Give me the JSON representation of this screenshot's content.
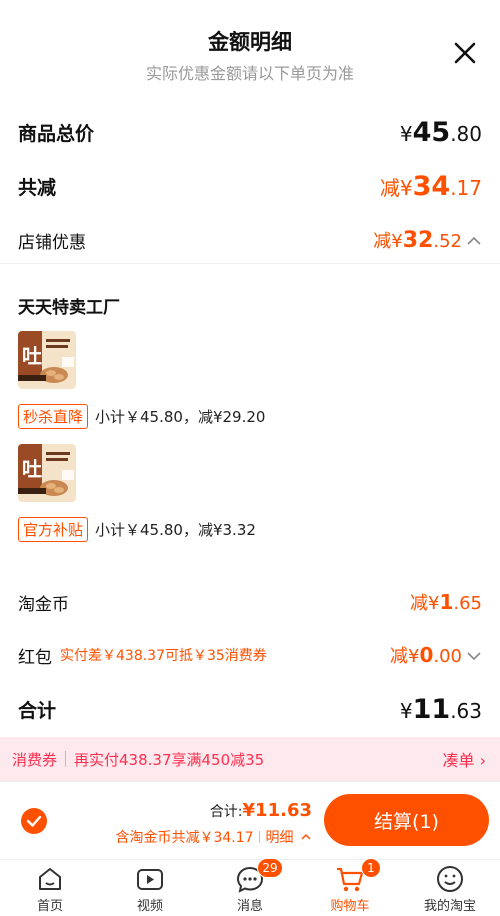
{
  "header": {
    "title": "金额明细",
    "subtitle": "实际优惠金额请以下单页为准"
  },
  "summary": {
    "total_label": "商品总价",
    "total_symbol": "¥",
    "total_int": "45",
    "total_dec": ".80",
    "reduce_label": "共减",
    "reduce_symbol": "减¥",
    "reduce_int": "34",
    "reduce_dec": ".17",
    "shop_label": "店铺优惠",
    "shop_symbol": "减¥",
    "shop_int": "32",
    "shop_dec": ".52"
  },
  "shop": {
    "name": "天天特卖工厂",
    "items": [
      {
        "tag": "秒杀直降",
        "text": "小计￥45.80，减¥29.20"
      },
      {
        "tag": "官方补贴",
        "text": "小计￥45.80，减¥3.32"
      }
    ]
  },
  "coins": {
    "label": "淘金币",
    "symbol": "减¥",
    "int": "1",
    "dec": ".65"
  },
  "hongbao": {
    "label": "红包",
    "note": "实付差￥438.37可抵￥35消费券",
    "symbol": "减¥",
    "int": "0",
    "dec": ".00"
  },
  "total": {
    "label": "合计",
    "symbol": "¥",
    "int": "11",
    "dec": ".63"
  },
  "banner": {
    "tag": "消费券",
    "text": "再实付438.37享满450减35",
    "action": "凑单 ›"
  },
  "checkout": {
    "sum_label": "合计: ",
    "sum_value": "¥11.63",
    "note": "含淘金币共减￥34.17",
    "detail": "明细",
    "button": "结算(1)"
  },
  "tabs": [
    {
      "label": "首页",
      "icon": "home-icon"
    },
    {
      "label": "视频",
      "icon": "video-icon"
    },
    {
      "label": "消息",
      "icon": "message-icon",
      "badge": "29"
    },
    {
      "label": "购物车",
      "icon": "cart-icon",
      "badge": "1",
      "active": true
    },
    {
      "label": "我的淘宝",
      "icon": "profile-icon"
    }
  ],
  "colors": {
    "accent": "#ff5000",
    "banner_bg": "#fde9ee",
    "banner_text": "#ff2e4d"
  }
}
